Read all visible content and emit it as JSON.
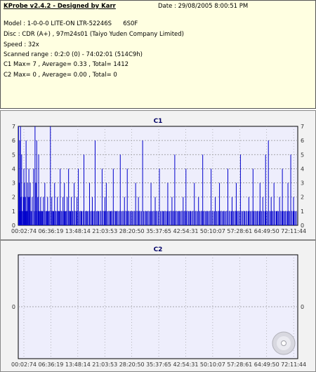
{
  "header": {
    "title": "KProbe v2.4.2 - Designed by Karr",
    "date": "Date : 29/08/2005 8:00:51 PM",
    "lines": [
      "Model : 1-0-0-0 LITE-ON LTR-52246S      6S0F",
      "Disc : CDR (A+) , 97m24s01 (Taiyo Yuden Company Limited)",
      "Speed : 32x",
      "Scanned range : 0:2:0 (0) - 74:02:01 (514C9h)",
      "C1 Max= 7 , Average= 0.33 , Total= 1412",
      "C2 Max= 0 , Average= 0.00 , Total= 0"
    ]
  },
  "colors": {
    "background": "#eeeefc",
    "series": "#0000cc",
    "grid": "#909090",
    "header_bg": "#ffffe1"
  },
  "chart_data": [
    {
      "type": "bar",
      "title": "C1",
      "xlabel": "",
      "ylabel": "",
      "ylim": [
        0,
        7
      ],
      "yticks": [
        "0",
        "1",
        "2",
        "3",
        "4",
        "5",
        "6",
        "7"
      ],
      "xticks": [
        "00:02:74",
        "06:36:19",
        "13:48:14",
        "21:03:53",
        "28:20:50",
        "35:37:65",
        "42:54:31",
        "50:10:07",
        "57:28:61",
        "64:49:50",
        "72:11:44"
      ],
      "grid": true,
      "x_frac": [
        0.001,
        0.003,
        0.005,
        0.008,
        0.01,
        0.012,
        0.015,
        0.018,
        0.02,
        0.022,
        0.025,
        0.028,
        0.03,
        0.033,
        0.035,
        0.038,
        0.04,
        0.043,
        0.046,
        0.05,
        0.055,
        0.06,
        0.063,
        0.066,
        0.07,
        0.073,
        0.076,
        0.08,
        0.085,
        0.09,
        0.095,
        0.1,
        0.105,
        0.11,
        0.115,
        0.12,
        0.125,
        0.13,
        0.135,
        0.14,
        0.145,
        0.15,
        0.155,
        0.16,
        0.165,
        0.17,
        0.175,
        0.18,
        0.185,
        0.19,
        0.195,
        0.2,
        0.21,
        0.215,
        0.225,
        0.235,
        0.245,
        0.255,
        0.265,
        0.275,
        0.285,
        0.3,
        0.31,
        0.315,
        0.33,
        0.34,
        0.35,
        0.365,
        0.38,
        0.39,
        0.405,
        0.42,
        0.43,
        0.445,
        0.46,
        0.475,
        0.49,
        0.505,
        0.52,
        0.535,
        0.55,
        0.56,
        0.575,
        0.59,
        0.6,
        0.615,
        0.63,
        0.645,
        0.66,
        0.675,
        0.69,
        0.705,
        0.72,
        0.735,
        0.75,
        0.765,
        0.78,
        0.795,
        0.81,
        0.825,
        0.84,
        0.855,
        0.865,
        0.875,
        0.885,
        0.895,
        0.905,
        0.915,
        0.925,
        0.935,
        0.945,
        0.955,
        0.965,
        0.975,
        0.985,
        0.995
      ],
      "values": [
        7,
        3,
        6,
        7,
        2,
        5,
        1,
        2,
        4,
        3,
        2,
        6,
        1,
        3,
        2,
        4,
        2,
        3,
        1,
        2,
        4,
        7,
        3,
        6,
        2,
        5,
        1,
        2,
        1,
        2,
        3,
        1,
        2,
        1,
        7,
        2,
        1,
        3,
        1,
        2,
        1,
        4,
        1,
        2,
        3,
        1,
        2,
        4,
        1,
        2,
        1,
        3,
        2,
        4,
        1,
        5,
        1,
        3,
        2,
        6,
        1,
        4,
        2,
        3,
        1,
        4,
        1,
        5,
        2,
        4,
        1,
        3,
        2,
        6,
        1,
        3,
        2,
        4,
        1,
        3,
        2,
        5,
        1,
        2,
        4,
        1,
        3,
        2,
        5,
        1,
        4,
        2,
        3,
        1,
        4,
        2,
        3,
        5,
        1,
        2,
        4,
        1,
        3,
        2,
        5,
        6,
        2,
        3,
        1,
        2,
        4,
        1,
        3,
        5,
        2
      ],
      "baseline_level": 1
    },
    {
      "type": "bar",
      "title": "C2",
      "xlabel": "",
      "ylabel": "",
      "ylim": [
        -1,
        1
      ],
      "yticks": [
        "0"
      ],
      "xticks": [
        "00:02:74",
        "06:36:19",
        "13:48:14",
        "21:03:53",
        "28:20:50",
        "35:37:65",
        "42:54:31",
        "50:10:07",
        "57:28:61",
        "64:49:50",
        "72:11:44"
      ],
      "grid": true,
      "values": []
    }
  ]
}
